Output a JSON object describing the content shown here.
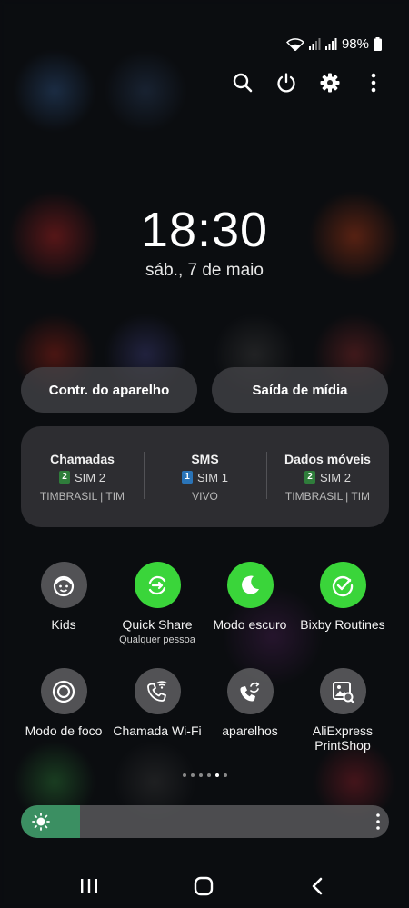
{
  "status_bar": {
    "battery": "98%"
  },
  "header_actions": {
    "search": "search-icon",
    "power": "power-icon",
    "settings": "gear-icon",
    "more": "more-vertical-icon"
  },
  "clock": {
    "time": "18:30",
    "date": "sáb., 7 de maio"
  },
  "buttons": {
    "device_control": "Contr. do aparelho",
    "media_output": "Saída de mídia"
  },
  "sim_card": [
    {
      "title": "Chamadas",
      "badge": "2",
      "badge_color": "#2f7d3b",
      "sim": "SIM 2",
      "operator": "TIMBRASIL | TIM"
    },
    {
      "title": "SMS",
      "badge": "1",
      "badge_color": "#2a74b8",
      "sim": "SIM 1",
      "operator": "VIVO"
    },
    {
      "title": "Dados móveis",
      "badge": "2",
      "badge_color": "#2f7d3b",
      "sim": "SIM 2",
      "operator": "TIMBRASIL | TIM"
    }
  ],
  "tiles": [
    {
      "label": "Kids",
      "sub": "",
      "icon": "kids-face-icon",
      "active": false
    },
    {
      "label": "Quick Share",
      "sub": "Qualquer pessoa",
      "icon": "quick-share-icon",
      "active": true
    },
    {
      "label": "Modo escuro",
      "sub": "",
      "icon": "moon-icon",
      "active": true
    },
    {
      "label": "Bixby Routines",
      "sub": "",
      "icon": "bixby-routines-icon",
      "active": true
    },
    {
      "label": "Modo de foco",
      "sub": "",
      "icon": "focus-mode-icon",
      "active": false
    },
    {
      "label": "Chamada Wi-Fi",
      "sub": "",
      "icon": "wifi-call-icon",
      "active": false
    },
    {
      "label": "aparelhos",
      "sub": "",
      "icon": "call-switch-icon",
      "active": false
    },
    {
      "label": "AliExpress PrintShop",
      "sub": "",
      "icon": "aliexpress-printshop-icon",
      "active": false
    }
  ],
  "page_indicator": {
    "count": 6,
    "active_index": 4
  },
  "brightness": {
    "level": 0.16,
    "color": "#3b8f62"
  },
  "nav_bar": {
    "recents": "recents-icon",
    "home": "home-icon",
    "back": "back-icon"
  }
}
